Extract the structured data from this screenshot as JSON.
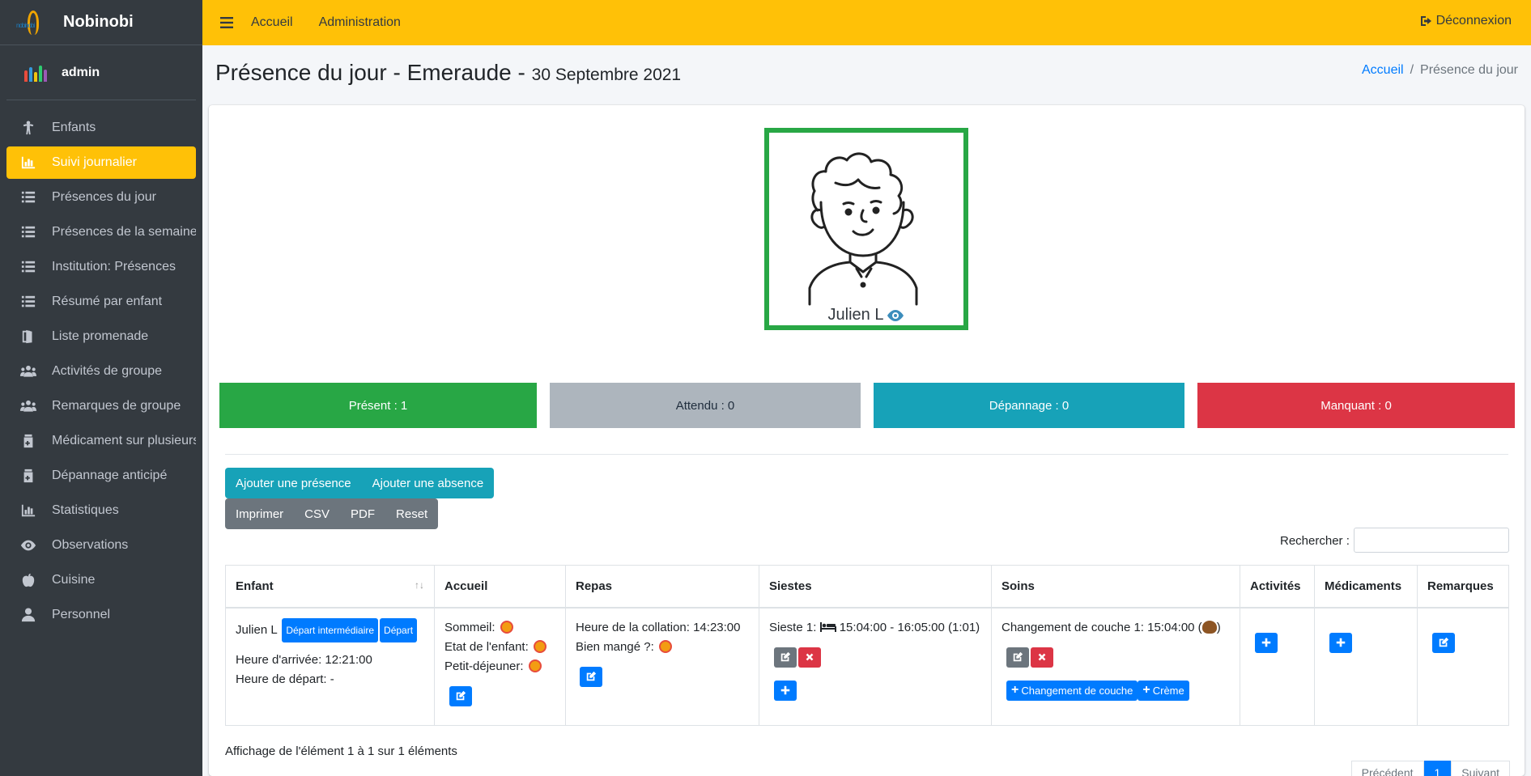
{
  "brand": {
    "name": "Nobinobi",
    "logo_text": "nobinobi"
  },
  "user": {
    "name": "admin"
  },
  "sidebar": {
    "items": [
      {
        "label": "Enfants",
        "icon": "child-icon"
      },
      {
        "label": "Suivi journalier",
        "icon": "chart-bar-icon",
        "active": true
      },
      {
        "label": "Présences du jour",
        "icon": "list-icon"
      },
      {
        "label": "Présences de la semaine",
        "icon": "list-icon"
      },
      {
        "label": "Institution: Présences",
        "icon": "list-icon"
      },
      {
        "label": "Résumé par enfant",
        "icon": "list-icon"
      },
      {
        "label": "Liste promenade",
        "icon": "door-icon"
      },
      {
        "label": "Activités de groupe",
        "icon": "users-icon"
      },
      {
        "label": "Remarques de groupe",
        "icon": "users-icon"
      },
      {
        "label": "Médicament sur plusieurs jo",
        "icon": "medkit-icon"
      },
      {
        "label": "Dépannage anticipé",
        "icon": "medkit-icon"
      },
      {
        "label": "Statistiques",
        "icon": "chart-bar-icon"
      },
      {
        "label": "Observations",
        "icon": "eye-icon"
      },
      {
        "label": "Cuisine",
        "icon": "apple-icon"
      },
      {
        "label": "Personnel",
        "icon": "user-icon"
      }
    ]
  },
  "topbar": {
    "home": "Accueil",
    "admin": "Administration",
    "logout": "Déconnexion"
  },
  "page": {
    "title": "Présence du jour - Emeraude - ",
    "date": "30 Septembre 2021"
  },
  "breadcrumb": {
    "home": "Accueil",
    "sep": "/",
    "current": "Présence du jour"
  },
  "child_card": {
    "name": "Julien L"
  },
  "stats": {
    "present": "Présent : 1",
    "expected": "Attendu : 0",
    "emergency": "Dépannage : 0",
    "missing": "Manquant : 0"
  },
  "colors": {
    "present": "#28a745",
    "expected": "#adb5bd",
    "emergency": "#17a2b8",
    "missing": "#dc3545",
    "accent": "#ffc107"
  },
  "actions": {
    "add_presence": "Ajouter une présence",
    "add_absence": "Ajouter une absence",
    "print": "Imprimer",
    "csv": "CSV",
    "pdf": "PDF",
    "reset": "Reset"
  },
  "search": {
    "label": "Rechercher :",
    "value": ""
  },
  "table": {
    "headers": [
      "Enfant",
      "Accueil",
      "Repas",
      "Siestes",
      "Soins",
      "Activités",
      "Médicaments",
      "Remarques"
    ],
    "row": {
      "child": "Julien L",
      "badge_intermediate": "Départ intermédiaire",
      "badge_departure": "Départ",
      "arrival": "Heure d'arrivée: 12:21:00",
      "departure": "Heure de départ: -",
      "sleep": "Sommeil:",
      "state": "Etat de l'enfant:",
      "breakfast": "Petit-déjeuner:",
      "snack": "Heure de la collation: 14:23:00",
      "ate_well": "Bien mangé ?:",
      "nap_label": "Sieste 1:",
      "nap_time": "15:04:00 - 16:05:00 (1:01)",
      "care": "Changement de couche 1: 15:04:00 (",
      "care_end": ")",
      "btn_diaper": "Changement de couche",
      "btn_cream": "Crème"
    }
  },
  "footer": {
    "info": "Affichage de l'élément 1 à 1 sur 1 éléments",
    "prev": "Précédent",
    "page": "1",
    "next": "Suivant"
  }
}
